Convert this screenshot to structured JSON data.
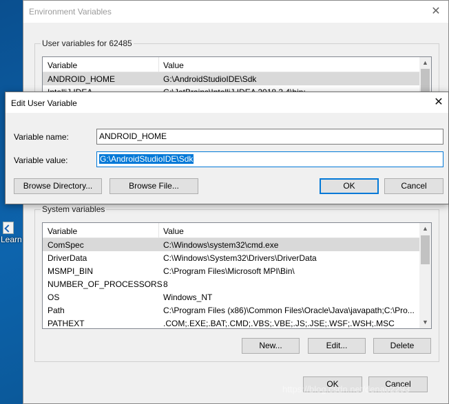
{
  "desktop": {
    "icon_label": "Learn"
  },
  "env_window": {
    "title": "Environment Variables",
    "close_glyph": "✕",
    "user_group_title": "User variables for 62485",
    "user_table": {
      "columns": [
        "Variable",
        "Value"
      ],
      "rows": [
        {
          "variable": "ANDROID_HOME",
          "value": "G:\\AndroidStudioIDE\\Sdk"
        },
        {
          "variable": "IntelliJ IDEA",
          "value": "G:\\JetBrains\\IntelliJ IDEA 2018.3.4\\bin;"
        }
      ]
    },
    "system_group_title": "System variables",
    "system_table": {
      "columns": [
        "Variable",
        "Value"
      ],
      "rows": [
        {
          "variable": "ComSpec",
          "value": "C:\\Windows\\system32\\cmd.exe"
        },
        {
          "variable": "DriverData",
          "value": "C:\\Windows\\System32\\Drivers\\DriverData"
        },
        {
          "variable": "MSMPI_BIN",
          "value": "C:\\Program Files\\Microsoft MPI\\Bin\\"
        },
        {
          "variable": "NUMBER_OF_PROCESSORS",
          "value": "8"
        },
        {
          "variable": "OS",
          "value": "Windows_NT"
        },
        {
          "variable": "Path",
          "value": "C:\\Program Files (x86)\\Common Files\\Oracle\\Java\\javapath;C:\\Pro..."
        },
        {
          "variable": "PATHEXT",
          "value": ".COM;.EXE;.BAT;.CMD;.VBS;.VBE;.JS;.JSE;.WSF;.WSH;.MSC"
        }
      ]
    },
    "system_buttons": {
      "new": "New...",
      "edit": "Edit...",
      "delete": "Delete"
    },
    "footer_buttons": {
      "ok": "OK",
      "cancel": "Cancel"
    }
  },
  "edit_dialog": {
    "title": "Edit User Variable",
    "close_glyph": "✕",
    "name_label": "Variable name:",
    "name_value": "ANDROID_HOME",
    "value_label": "Variable value:",
    "value_value": "G:\\AndroidStudioIDE\\Sdk",
    "buttons": {
      "browse_directory": "Browse Directory...",
      "browse_file": "Browse File...",
      "ok": "OK",
      "cancel": "Cancel"
    }
  },
  "watermark": "https://blog.csdn.net/denao2293",
  "colors": {
    "accent": "#0078d7",
    "selection": "#d9d9d9",
    "desktop": "#0d64ad"
  }
}
